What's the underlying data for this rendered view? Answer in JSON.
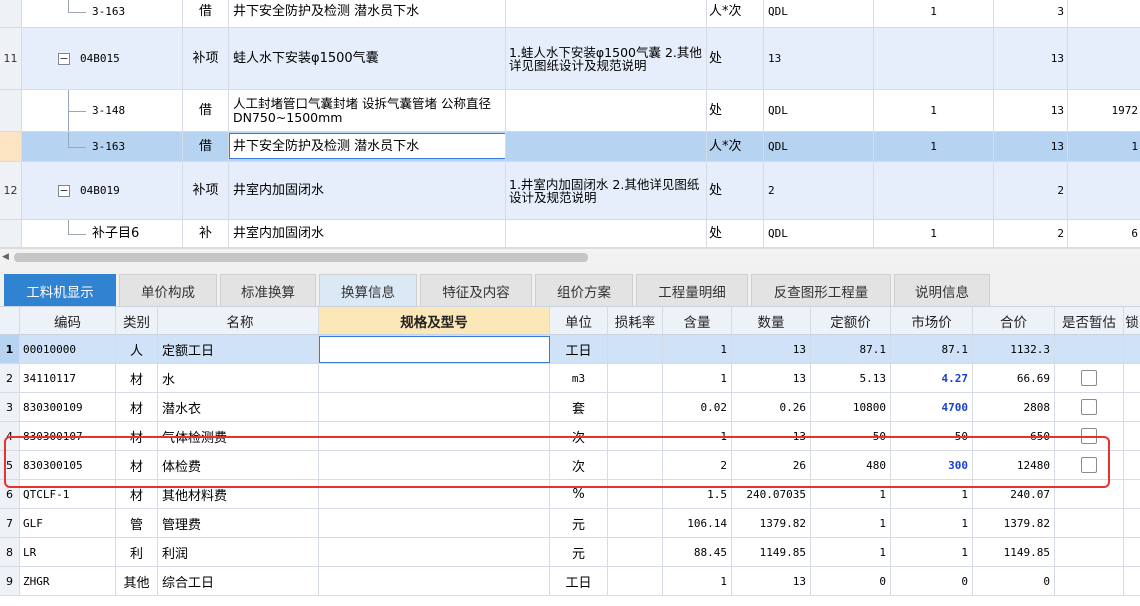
{
  "upper": {
    "rows": [
      {
        "row_no": "",
        "code": "3-163",
        "type": "借",
        "name": "井下安全防护及检测 潜水员下水",
        "desc": "",
        "unit": "人*次",
        "qty_expr": "QDL",
        "content": "1",
        "quantity": "3",
        "price": ""
      },
      {
        "row_no": "11",
        "code": "04B015",
        "type": "补项",
        "name": "蛙人水下安装φ1500气囊",
        "desc": "1.蛙人水下安装φ1500气囊 2.其他详见图纸设计及规范说明",
        "unit": "处",
        "qty_expr": "13",
        "content": "",
        "quantity": "13",
        "price": ""
      },
      {
        "row_no": "",
        "code": "3-148",
        "type": "借",
        "name": "人工封堵管口气囊封堵 设拆气囊管堵 公称直径 DN750~1500mm",
        "desc": "",
        "unit": "处",
        "qty_expr": "QDL",
        "content": "1",
        "quantity": "13",
        "price": "1972"
      },
      {
        "row_no": "",
        "code": "3-163",
        "type": "借",
        "name": "井下安全防护及检测 潜水员下水",
        "desc": "",
        "unit": "人*次",
        "qty_expr": "QDL",
        "content": "1",
        "quantity": "13",
        "price": "1"
      },
      {
        "row_no": "12",
        "code": "04B019",
        "type": "补项",
        "name": "井室内加固闭水",
        "desc": "1.井室内加固闭水 2.其他详见图纸设计及规范说明",
        "unit": "处",
        "qty_expr": "2",
        "content": "",
        "quantity": "2",
        "price": ""
      },
      {
        "row_no": "",
        "code": "补子目6",
        "type": "补",
        "name": "井室内加固闭水",
        "desc": "",
        "unit": "处",
        "qty_expr": "QDL",
        "content": "1",
        "quantity": "2",
        "price": "6"
      }
    ]
  },
  "tabs": [
    "工料机显示",
    "单价构成",
    "标准换算",
    "换算信息",
    "特征及内容",
    "组价方案",
    "工程量明细",
    "反查图形工程量",
    "说明信息"
  ],
  "lower": {
    "headers": {
      "code": "编码",
      "type": "类别",
      "name": "名称",
      "spec": "规格及型号",
      "unit": "单位",
      "loss": "损耗率",
      "content": "含量",
      "qty": "数量",
      "quota_price": "定额价",
      "market_price": "市场价",
      "total": "合价",
      "provisional": "是否暂估",
      "locked": "锁"
    },
    "rows": [
      {
        "no": "1",
        "code": "00010000",
        "type": "人",
        "name": "定额工日",
        "spec": "",
        "unit": "工日",
        "loss": "",
        "content": "1",
        "qty": "13",
        "quota_price": "87.1",
        "market_price": "87.1",
        "total": "1132.3"
      },
      {
        "no": "2",
        "code": "34110117",
        "type": "材",
        "name": "水",
        "spec": "",
        "unit": "m3",
        "loss": "",
        "content": "1",
        "qty": "13",
        "quota_price": "5.13",
        "market_price": "4.27",
        "total": "66.69"
      },
      {
        "no": "3",
        "code": "830300109",
        "type": "材",
        "name": "潜水衣",
        "spec": "",
        "unit": "套",
        "loss": "",
        "content": "0.02",
        "qty": "0.26",
        "quota_price": "10800",
        "market_price": "4700",
        "total": "2808"
      },
      {
        "no": "4",
        "code": "830300107",
        "type": "材",
        "name": "气体检测费",
        "spec": "",
        "unit": "次",
        "loss": "",
        "content": "1",
        "qty": "13",
        "quota_price": "50",
        "market_price": "50",
        "total": "650"
      },
      {
        "no": "5",
        "code": "830300105",
        "type": "材",
        "name": "体检费",
        "spec": "",
        "unit": "次",
        "loss": "",
        "content": "2",
        "qty": "26",
        "quota_price": "480",
        "market_price": "300",
        "total": "12480"
      },
      {
        "no": "6",
        "code": "QTCLF-1",
        "type": "材",
        "name": "其他材料费",
        "spec": "",
        "unit": "%",
        "loss": "",
        "content": "1.5",
        "qty": "240.07035",
        "quota_price": "1",
        "market_price": "1",
        "total": "240.07"
      },
      {
        "no": "7",
        "code": "GLF",
        "type": "管",
        "name": "管理费",
        "spec": "",
        "unit": "元",
        "loss": "",
        "content": "106.14",
        "qty": "1379.82",
        "quota_price": "1",
        "market_price": "1",
        "total": "1379.82"
      },
      {
        "no": "8",
        "code": "LR",
        "type": "利",
        "name": "利润",
        "spec": "",
        "unit": "元",
        "loss": "",
        "content": "88.45",
        "qty": "1149.85",
        "quota_price": "1",
        "market_price": "1",
        "total": "1149.85"
      },
      {
        "no": "9",
        "code": "ZHGR",
        "type": "其他",
        "name": "综合工日",
        "spec": "",
        "unit": "工日",
        "loss": "",
        "content": "1",
        "qty": "13",
        "quota_price": "0",
        "market_price": "0",
        "total": "0"
      }
    ]
  },
  "colors": {
    "accent": "#2f83d0",
    "highlight_border": "#e8322d",
    "market_price_changed": "#1a3fd1",
    "selected_row": "#b7d3f2"
  }
}
